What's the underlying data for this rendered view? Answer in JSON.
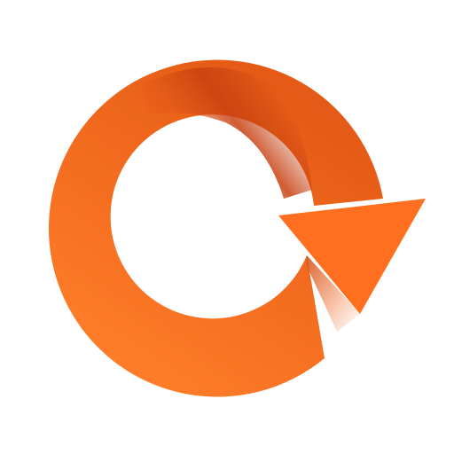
{
  "icon": {
    "name": "circular-arrow-refresh-icon",
    "colors": {
      "primary": "#FF6F1F",
      "light": "#FF7E2A",
      "shadow": "#C94010",
      "background": "#FFFFFF"
    }
  }
}
